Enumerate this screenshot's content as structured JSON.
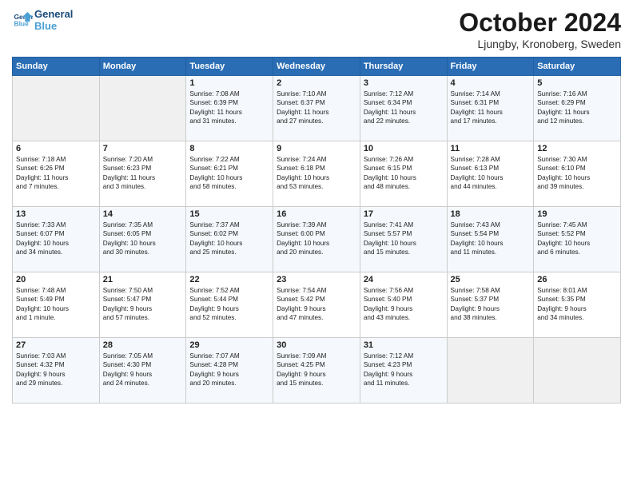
{
  "logo": {
    "line1": "General",
    "line2": "Blue"
  },
  "title": "October 2024",
  "location": "Ljungby, Kronoberg, Sweden",
  "headers": [
    "Sunday",
    "Monday",
    "Tuesday",
    "Wednesday",
    "Thursday",
    "Friday",
    "Saturday"
  ],
  "weeks": [
    [
      {
        "day": "",
        "info": ""
      },
      {
        "day": "",
        "info": ""
      },
      {
        "day": "1",
        "info": "Sunrise: 7:08 AM\nSunset: 6:39 PM\nDaylight: 11 hours\nand 31 minutes."
      },
      {
        "day": "2",
        "info": "Sunrise: 7:10 AM\nSunset: 6:37 PM\nDaylight: 11 hours\nand 27 minutes."
      },
      {
        "day": "3",
        "info": "Sunrise: 7:12 AM\nSunset: 6:34 PM\nDaylight: 11 hours\nand 22 minutes."
      },
      {
        "day": "4",
        "info": "Sunrise: 7:14 AM\nSunset: 6:31 PM\nDaylight: 11 hours\nand 17 minutes."
      },
      {
        "day": "5",
        "info": "Sunrise: 7:16 AM\nSunset: 6:29 PM\nDaylight: 11 hours\nand 12 minutes."
      }
    ],
    [
      {
        "day": "6",
        "info": "Sunrise: 7:18 AM\nSunset: 6:26 PM\nDaylight: 11 hours\nand 7 minutes."
      },
      {
        "day": "7",
        "info": "Sunrise: 7:20 AM\nSunset: 6:23 PM\nDaylight: 11 hours\nand 3 minutes."
      },
      {
        "day": "8",
        "info": "Sunrise: 7:22 AM\nSunset: 6:21 PM\nDaylight: 10 hours\nand 58 minutes."
      },
      {
        "day": "9",
        "info": "Sunrise: 7:24 AM\nSunset: 6:18 PM\nDaylight: 10 hours\nand 53 minutes."
      },
      {
        "day": "10",
        "info": "Sunrise: 7:26 AM\nSunset: 6:15 PM\nDaylight: 10 hours\nand 48 minutes."
      },
      {
        "day": "11",
        "info": "Sunrise: 7:28 AM\nSunset: 6:13 PM\nDaylight: 10 hours\nand 44 minutes."
      },
      {
        "day": "12",
        "info": "Sunrise: 7:30 AM\nSunset: 6:10 PM\nDaylight: 10 hours\nand 39 minutes."
      }
    ],
    [
      {
        "day": "13",
        "info": "Sunrise: 7:33 AM\nSunset: 6:07 PM\nDaylight: 10 hours\nand 34 minutes."
      },
      {
        "day": "14",
        "info": "Sunrise: 7:35 AM\nSunset: 6:05 PM\nDaylight: 10 hours\nand 30 minutes."
      },
      {
        "day": "15",
        "info": "Sunrise: 7:37 AM\nSunset: 6:02 PM\nDaylight: 10 hours\nand 25 minutes."
      },
      {
        "day": "16",
        "info": "Sunrise: 7:39 AM\nSunset: 6:00 PM\nDaylight: 10 hours\nand 20 minutes."
      },
      {
        "day": "17",
        "info": "Sunrise: 7:41 AM\nSunset: 5:57 PM\nDaylight: 10 hours\nand 15 minutes."
      },
      {
        "day": "18",
        "info": "Sunrise: 7:43 AM\nSunset: 5:54 PM\nDaylight: 10 hours\nand 11 minutes."
      },
      {
        "day": "19",
        "info": "Sunrise: 7:45 AM\nSunset: 5:52 PM\nDaylight: 10 hours\nand 6 minutes."
      }
    ],
    [
      {
        "day": "20",
        "info": "Sunrise: 7:48 AM\nSunset: 5:49 PM\nDaylight: 10 hours\nand 1 minute."
      },
      {
        "day": "21",
        "info": "Sunrise: 7:50 AM\nSunset: 5:47 PM\nDaylight: 9 hours\nand 57 minutes."
      },
      {
        "day": "22",
        "info": "Sunrise: 7:52 AM\nSunset: 5:44 PM\nDaylight: 9 hours\nand 52 minutes."
      },
      {
        "day": "23",
        "info": "Sunrise: 7:54 AM\nSunset: 5:42 PM\nDaylight: 9 hours\nand 47 minutes."
      },
      {
        "day": "24",
        "info": "Sunrise: 7:56 AM\nSunset: 5:40 PM\nDaylight: 9 hours\nand 43 minutes."
      },
      {
        "day": "25",
        "info": "Sunrise: 7:58 AM\nSunset: 5:37 PM\nDaylight: 9 hours\nand 38 minutes."
      },
      {
        "day": "26",
        "info": "Sunrise: 8:01 AM\nSunset: 5:35 PM\nDaylight: 9 hours\nand 34 minutes."
      }
    ],
    [
      {
        "day": "27",
        "info": "Sunrise: 7:03 AM\nSunset: 4:32 PM\nDaylight: 9 hours\nand 29 minutes."
      },
      {
        "day": "28",
        "info": "Sunrise: 7:05 AM\nSunset: 4:30 PM\nDaylight: 9 hours\nand 24 minutes."
      },
      {
        "day": "29",
        "info": "Sunrise: 7:07 AM\nSunset: 4:28 PM\nDaylight: 9 hours\nand 20 minutes."
      },
      {
        "day": "30",
        "info": "Sunrise: 7:09 AM\nSunset: 4:25 PM\nDaylight: 9 hours\nand 15 minutes."
      },
      {
        "day": "31",
        "info": "Sunrise: 7:12 AM\nSunset: 4:23 PM\nDaylight: 9 hours\nand 11 minutes."
      },
      {
        "day": "",
        "info": ""
      },
      {
        "day": "",
        "info": ""
      }
    ]
  ]
}
